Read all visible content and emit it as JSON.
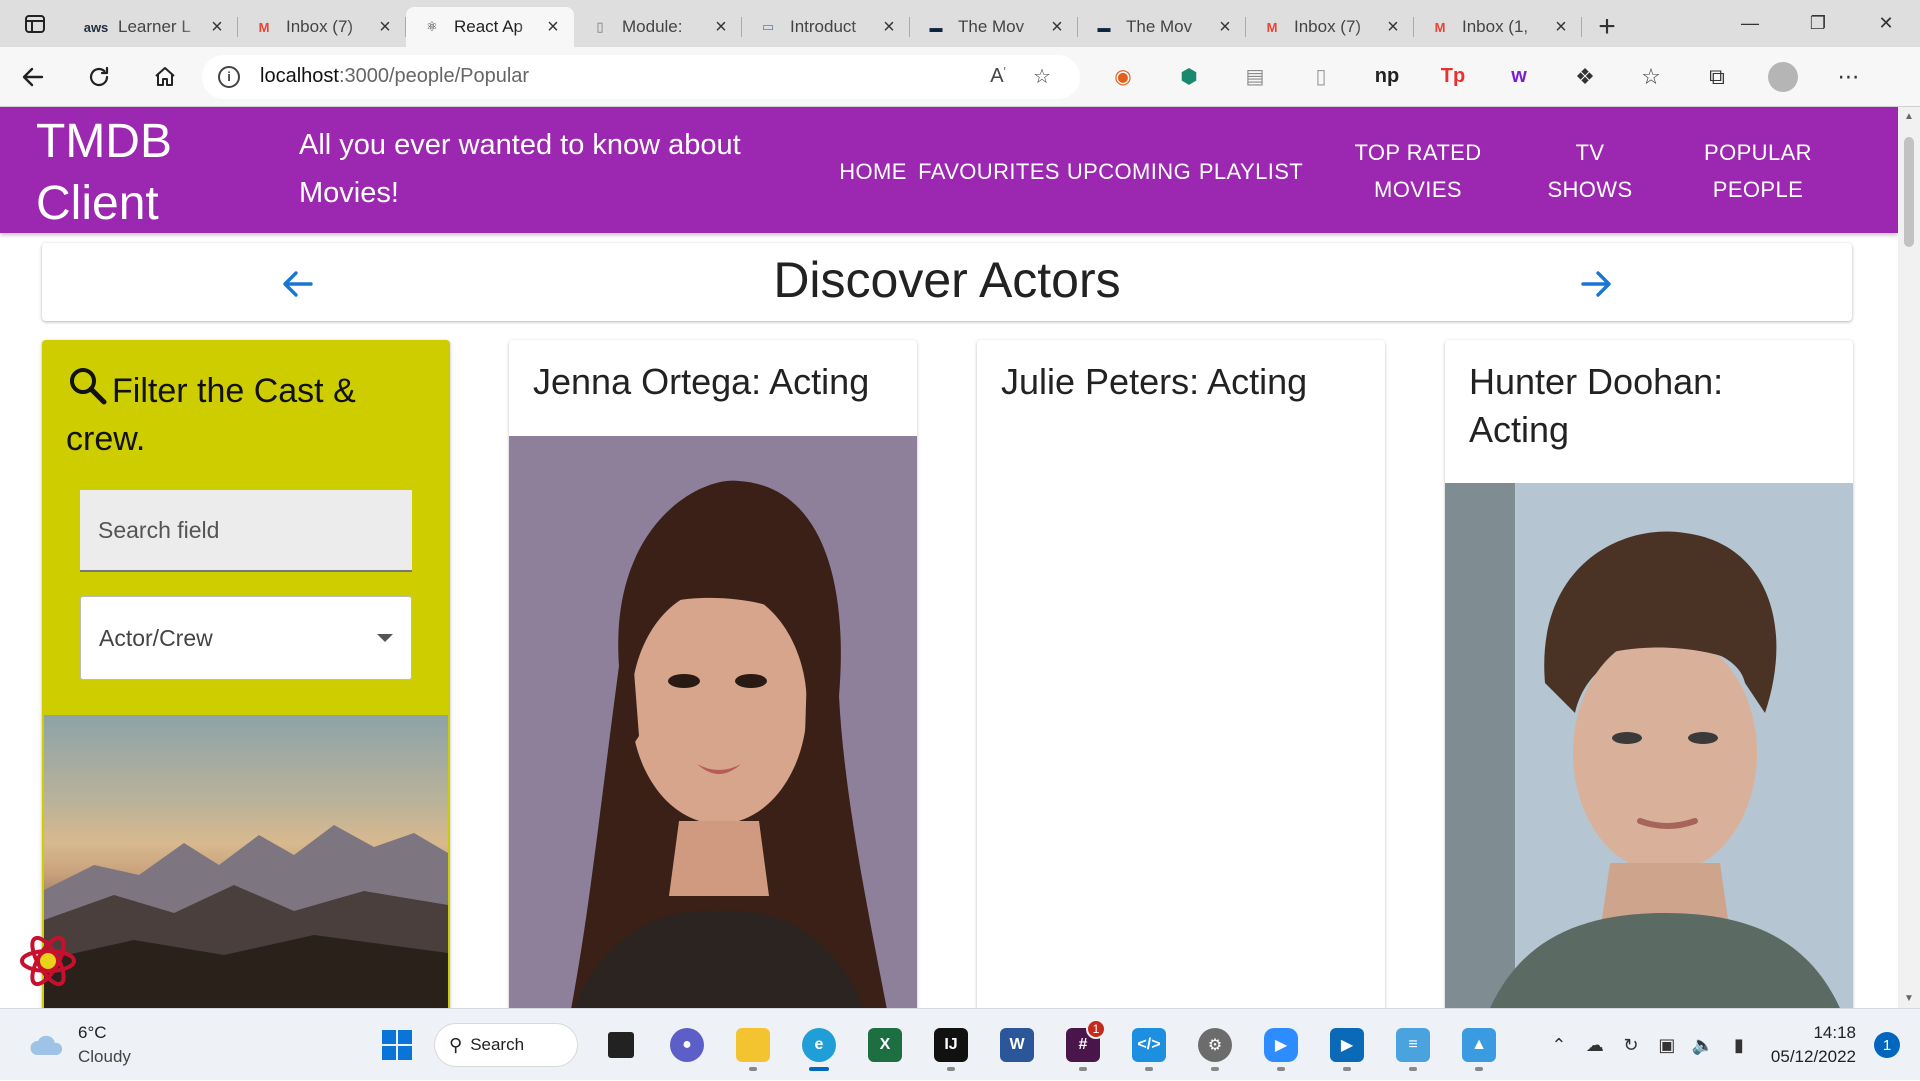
{
  "browser": {
    "tabs": [
      {
        "title": "Learner L",
        "favicon": "aws-icon",
        "favicon_text": "aws",
        "favicon_color": "#232f3e",
        "active": false
      },
      {
        "title": "Inbox (7)",
        "favicon": "gmail-icon",
        "favicon_text": "M",
        "favicon_color": "#ea4335",
        "active": false
      },
      {
        "title": "React Ap",
        "favicon": "react-icon",
        "favicon_text": "⚛",
        "favicon_color": "#1f2430",
        "active": true
      },
      {
        "title": "Module:",
        "favicon": "document-icon",
        "favicon_text": "▯",
        "favicon_color": "#777777",
        "active": false
      },
      {
        "title": "Introduct",
        "favicon": "book-icon",
        "favicon_text": "▭",
        "favicon_color": "#5b7db1",
        "active": false
      },
      {
        "title": "The Mov",
        "favicon": "tmdb-icon",
        "favicon_text": "▬",
        "favicon_color": "#0d253f",
        "active": false
      },
      {
        "title": "The Mov",
        "favicon": "tmdb-icon",
        "favicon_text": "▬",
        "favicon_color": "#0d253f",
        "active": false
      },
      {
        "title": "Inbox (7)",
        "favicon": "gmail-icon",
        "favicon_text": "M",
        "favicon_color": "#ea4335",
        "active": false
      },
      {
        "title": "Inbox (1,",
        "favicon": "gmail-icon",
        "favicon_text": "M",
        "favicon_color": "#ea4335",
        "active": false
      }
    ],
    "url_host": "localhost",
    "url_path": ":3000/people/Popular",
    "extensions": [
      {
        "name": "ext-circle-icon",
        "text": "◉",
        "color": "#e0611f"
      },
      {
        "name": "ext-shield-icon",
        "text": "⬢",
        "color": "#1a8a6e"
      },
      {
        "name": "ext-stack-icon",
        "text": "▤",
        "color": "#8a8a8a"
      },
      {
        "name": "ext-page-icon",
        "text": "▯",
        "color": "#9a9a9a"
      },
      {
        "name": "ext-np-icon",
        "text": "np",
        "color": "#222222"
      },
      {
        "name": "ext-tp-icon",
        "text": "Tp",
        "color": "#e8322d"
      },
      {
        "name": "ext-w-icon",
        "text": "w",
        "color": "#7a1fd1"
      }
    ]
  },
  "app": {
    "title": "TMDB Client",
    "tagline": "All you ever wanted to know about Movies!",
    "menu": [
      {
        "id": "home",
        "label": "Home"
      },
      {
        "id": "favourites",
        "label": "Favourites"
      },
      {
        "id": "upcoming",
        "label": "Upcoming"
      },
      {
        "id": "playlist",
        "label": "Playlist"
      },
      {
        "id": "top-rated-movies",
        "label": "Top Rated Movies"
      },
      {
        "id": "tv-shows",
        "label": "TV Shows"
      },
      {
        "id": "popular-people",
        "label": "Popular People"
      }
    ],
    "colors": {
      "appbar": "#9c27b0",
      "filter_card": "#cdcd00",
      "arrow": "#1976d2"
    }
  },
  "discover": {
    "title": "Discover Actors"
  },
  "filter": {
    "heading": "Filter the Cast & crew.",
    "search_placeholder": "Search field",
    "select_value": "Actor/Crew"
  },
  "actors": [
    {
      "name": "Jenna Ortega: Acting",
      "has_photo": true
    },
    {
      "name": "Julie Peters: Acting",
      "has_photo": false
    },
    {
      "name": "Hunter Doohan: Acting",
      "has_photo": true
    }
  ],
  "taskbar": {
    "weather_temp": "6°C",
    "weather_cond": "Cloudy",
    "search_label": "Search",
    "time": "14:18",
    "date": "05/12/2022",
    "notifications": "1",
    "teams_badge": "1"
  }
}
